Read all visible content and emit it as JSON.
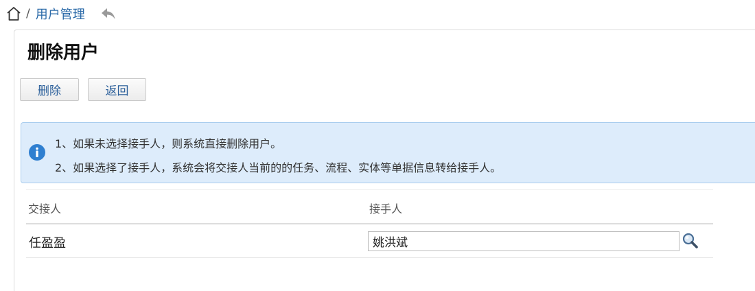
{
  "breadcrumb": {
    "separator": "/",
    "current": "用户管理"
  },
  "page": {
    "title": "删除用户"
  },
  "toolbar": {
    "delete_label": "删除",
    "back_label": "返回"
  },
  "info": {
    "icon": "info-circle-icon",
    "lines": [
      "1、如果未选择接手人，则系统直接删除用户。",
      "2、如果选择了接手人，系统会将交接人当前的的任务、流程、实体等单据信息转给接手人。"
    ]
  },
  "table": {
    "headers": [
      "交接人",
      "接手人"
    ],
    "rows": [
      {
        "handover": "任盈盈",
        "receiver": "姚洪斌"
      }
    ]
  },
  "icons": {
    "home": "home-icon",
    "back": "back-arrow-icon",
    "search": "search-icon"
  },
  "colors": {
    "link": "#2b6aa8",
    "info_bg": "#ddecfb",
    "info_border": "#a9cdee",
    "info_icon": "#2f7fd0"
  }
}
